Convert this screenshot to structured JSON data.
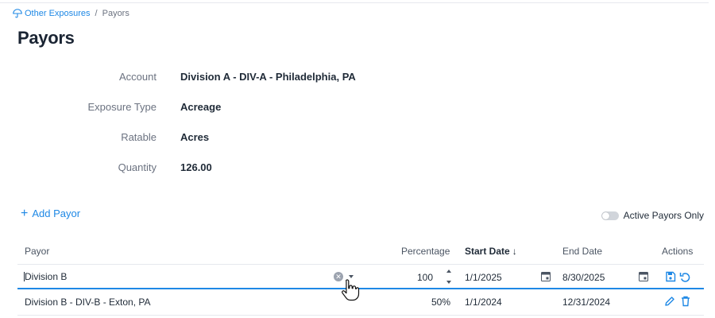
{
  "breadcrumb": {
    "parent": "Other Exposures",
    "separator": "/",
    "current": "Payors"
  },
  "page": {
    "title": "Payors"
  },
  "details": [
    {
      "label": "Account",
      "value": "Division A - DIV-A - Philadelphia, PA"
    },
    {
      "label": "Exposure Type",
      "value": "Acreage"
    },
    {
      "label": "Ratable",
      "value": "Acres"
    },
    {
      "label": "Quantity",
      "value": "126.00"
    }
  ],
  "toolbar": {
    "add_label": "Add Payor",
    "toggle_label": "Active Payors Only",
    "toggle_on": false
  },
  "table": {
    "headers": {
      "payor": "Payor",
      "percentage": "Percentage",
      "start_date": "Start Date",
      "sort_arrow": "↓",
      "end_date": "End Date",
      "actions": "Actions"
    },
    "edit_row": {
      "payor": "Division B",
      "percentage": "100",
      "start_date": "1/1/2025",
      "end_date": "8/30/2025"
    },
    "rows": [
      {
        "payor": "Division B - DIV-B - Exton, PA",
        "percentage": "50%",
        "start_date": "1/1/2024",
        "end_date": "12/31/2024"
      }
    ]
  },
  "colors": {
    "accent": "#1e88e5",
    "text": "#1f2a37",
    "muted": "#6b7280",
    "border": "#e6e9ee"
  }
}
